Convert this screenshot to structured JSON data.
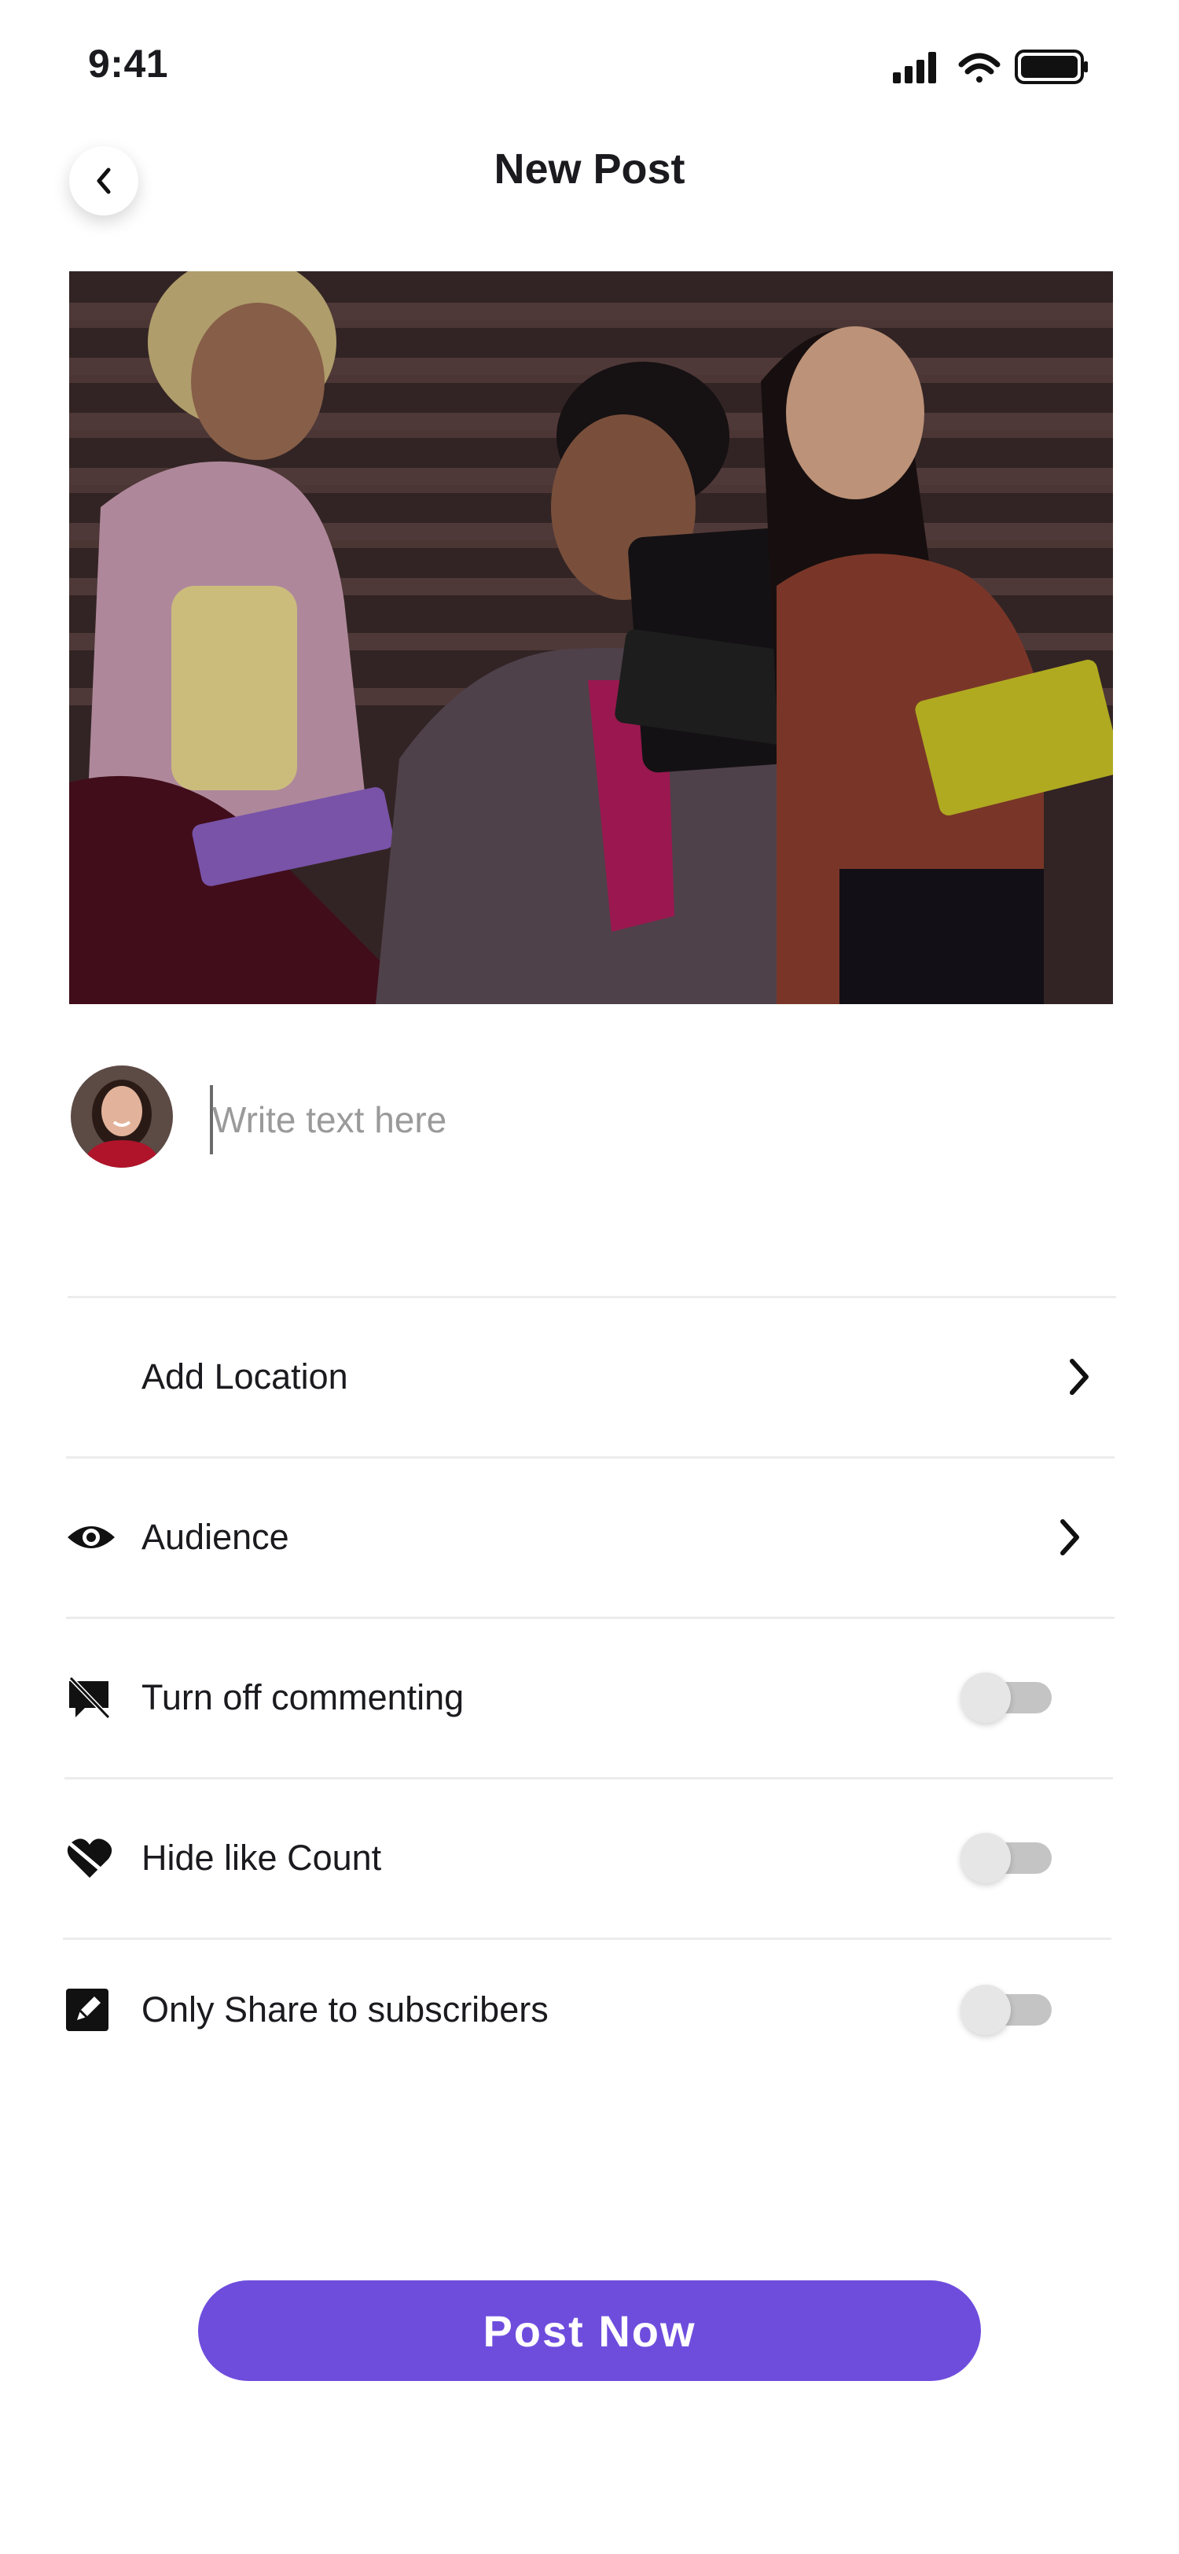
{
  "status_bar": {
    "time": "9:41"
  },
  "header": {
    "title": "New Post"
  },
  "composer": {
    "placeholder": "Write text here"
  },
  "settings": {
    "location_label": "Add Location",
    "audience_label": "Audience",
    "commenting_label": "Turn off commenting",
    "commenting_on": false,
    "like_count_label": "Hide like Count",
    "like_count_on": false,
    "subscribers_label": "Only Share to subscribers",
    "subscribers_on": false
  },
  "cta": {
    "label": "Post Now"
  },
  "colors": {
    "accent": "#6e4ddd",
    "toggle_track": "#c4c4c4",
    "divider": "#ececec"
  }
}
